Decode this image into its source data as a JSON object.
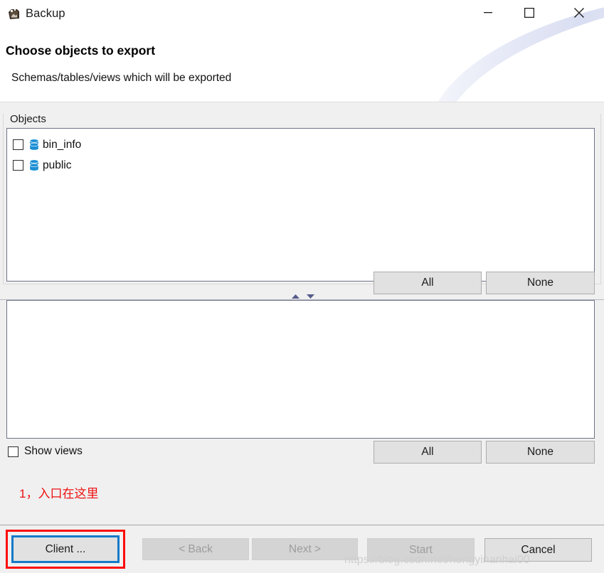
{
  "window": {
    "title": "Backup",
    "icon": "app-backup-icon",
    "controls": {
      "minimize": "minimize-icon",
      "maximize": "maximize-icon",
      "close": "close-icon"
    }
  },
  "header": {
    "title": "Choose objects to export",
    "subtitle": "Schemas/tables/views which will be exported"
  },
  "objects_group": {
    "label": "Objects",
    "items": [
      {
        "label": "bin_info",
        "checked": false,
        "icon": "database-schema-icon"
      },
      {
        "label": "public",
        "checked": false,
        "icon": "database-schema-icon"
      }
    ]
  },
  "selection_buttons": {
    "all": "All",
    "none": "None"
  },
  "detail_list": {
    "items": []
  },
  "show_views": {
    "label": "Show views",
    "checked": false
  },
  "annotation": {
    "text": "1，入口在这里",
    "color": "#ee1111",
    "highlight_color": "#fc0a0a"
  },
  "footer": {
    "client": "Client ...",
    "back": "< Back",
    "next": "Next >",
    "start": "Start",
    "cancel": "Cancel",
    "focus_color": "#1479c8"
  },
  "watermark": "https://blog.csdn.net/hongyinanhai00"
}
